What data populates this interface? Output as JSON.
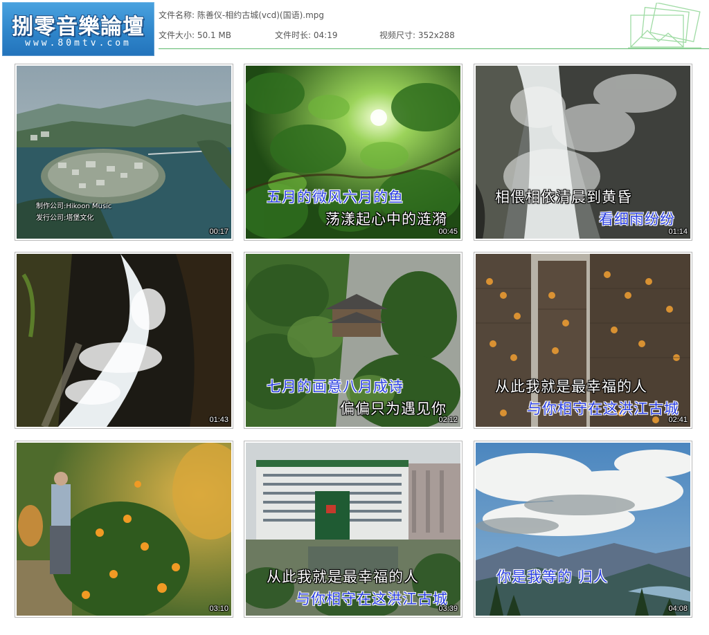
{
  "header": {
    "logo_title": "捌零音樂論壇",
    "logo_url": "www.80mtv.com",
    "file_name_label": "文件名称:",
    "file_name": "陈善仪-相约古城(vcd)(国语).mpg",
    "file_size_label": "文件大小:",
    "file_size": "50.1 MB",
    "duration_label": "文件时长:",
    "duration": "04:19",
    "resolution_label": "视频尺寸:",
    "resolution": "352x288",
    "accent_color": "#5bb86a"
  },
  "thumbnails": [
    {
      "timestamp": "00:17",
      "credits": [
        "制作公司:Hikoon Music",
        "发行公司:塔堡文化"
      ],
      "lyrics": []
    },
    {
      "timestamp": "00:45",
      "lyrics": [
        "五月的微风六月的鱼",
        "荡漾起心中的涟漪"
      ]
    },
    {
      "timestamp": "01:14",
      "lyrics": [
        "相偎相依清晨到黄昏",
        "看细雨纷纷"
      ]
    },
    {
      "timestamp": "01:43",
      "lyrics": []
    },
    {
      "timestamp": "02:12",
      "lyrics": [
        "七月的画意八月成诗",
        "偏偏只为遇见你"
      ]
    },
    {
      "timestamp": "02:41",
      "lyrics": [
        "从此我就是最幸福的人",
        "与你相守在这洪江古城"
      ]
    },
    {
      "timestamp": "03:10",
      "lyrics": []
    },
    {
      "timestamp": "03:39",
      "lyrics": [
        "从此我就是最幸福的人",
        "与你相守在这洪江古城"
      ]
    },
    {
      "timestamp": "04:08",
      "lyrics": [
        "你是我等的 归人"
      ]
    }
  ]
}
